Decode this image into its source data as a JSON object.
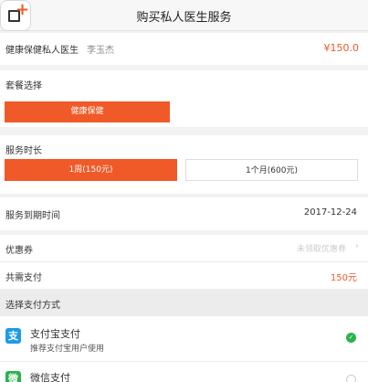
{
  "header": {
    "title": "购买私人医生服务"
  },
  "service": {
    "name": "健康保健私人医生",
    "doctor": "李玉杰",
    "price": "¥150.0"
  },
  "package": {
    "label": "套餐选择",
    "selected": "健康保健"
  },
  "duration": {
    "label": "服务时长",
    "options": [
      "1周(150元)",
      "1个月(600元)"
    ],
    "selected_index": 0
  },
  "expiry": {
    "label": "服务到期时间",
    "value": "2017-12-24"
  },
  "coupon": {
    "label": "优惠券",
    "placeholder": "未领取优惠券"
  },
  "total": {
    "label": "共需支付",
    "value": "150元"
  },
  "payment": {
    "label": "选择支付方式",
    "methods": [
      {
        "name": "支付宝支付",
        "desc": "推荐支付宝用户使用",
        "selected": true
      },
      {
        "name": "微信支付",
        "selected": false
      }
    ]
  },
  "colors": {
    "accent": "#f05a28",
    "alipay": "#1c9be6",
    "wechat": "#2bb24c",
    "check": "#2bb24c"
  },
  "icons": {
    "logo": "add-app-icon",
    "alipay": "alipay-icon",
    "wechat": "wechat-icon",
    "check": "check-circle-icon"
  }
}
